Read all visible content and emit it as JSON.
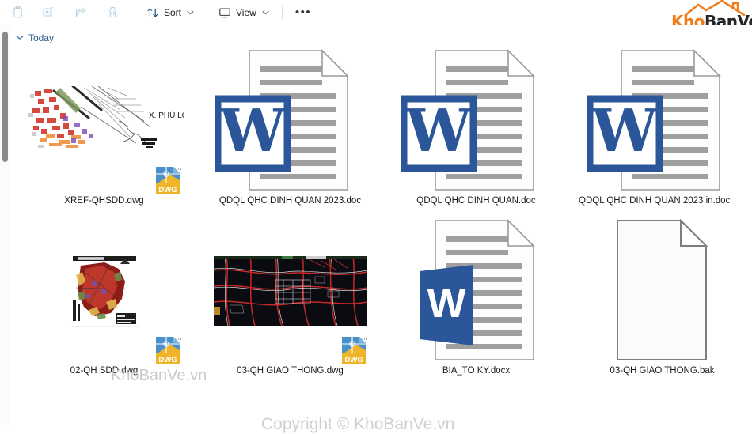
{
  "toolbar": {
    "buttons": [
      {
        "name": "paste-button",
        "icon": "paste-icon",
        "label": "",
        "disabled": true
      },
      {
        "name": "rename-button",
        "icon": "rename-icon",
        "label": "",
        "disabled": true
      },
      {
        "name": "share-button",
        "icon": "share-icon",
        "label": "",
        "disabled": true
      },
      {
        "name": "delete-button",
        "icon": "trash-icon",
        "label": "",
        "disabled": true
      }
    ],
    "sort_label": "Sort",
    "view_label": "View",
    "overflow_label": "•••"
  },
  "logo": {
    "part1": "Kho",
    "part2": "BanVe",
    "color1": "#ef7d1a",
    "color2": "#262626"
  },
  "group": {
    "title": "Today",
    "expanded": true
  },
  "files": [
    {
      "name": "XREF-QHSDD.dwg",
      "type": "dwg",
      "thumb": "cad-map-light",
      "thumb_text": "X. PHÚ LỢI",
      "has_dwg_badge": true,
      "truncated": false
    },
    {
      "name": "QDQL QHC DINH QUAN 2023.doc",
      "type": "doc",
      "thumb": "word-doc-classic",
      "has_dwg_badge": false,
      "truncated": false
    },
    {
      "name": "QDQL QHC DINH QUAN.doc",
      "type": "doc",
      "thumb": "word-doc-classic",
      "has_dwg_badge": false,
      "truncated": false
    },
    {
      "name": "QDQL QHC DINH QUAN 2023 in.doc",
      "type": "doc",
      "thumb": "word-doc-classic",
      "has_dwg_badge": false,
      "truncated": true
    },
    {
      "name": "02-QH SDD.dwg",
      "type": "dwg",
      "thumb": "cad-map-color",
      "has_dwg_badge": true,
      "truncated": false
    },
    {
      "name": "03-QH GIAO THONG.dwg",
      "type": "dwg",
      "thumb": "cad-map-dark",
      "has_dwg_badge": true,
      "truncated": false
    },
    {
      "name": "BIA_TO KY.docx",
      "type": "docx",
      "thumb": "word-docx-modern",
      "has_dwg_badge": false,
      "truncated": false
    },
    {
      "name": "03-QH GIAO THONG.bak",
      "type": "bak",
      "thumb": "blank-page",
      "has_dwg_badge": false,
      "truncated": false
    }
  ],
  "watermarks": {
    "middle": "KhoBanVe.vn",
    "bottom": "Copyright © KhoBanVe.vn"
  },
  "colors": {
    "word_blue": "#2b579a",
    "dwg_blue": "#4a90c9",
    "dwg_yellow": "#f0b429",
    "accent_orange": "#ef7d1a",
    "group_header": "#2f5f8f"
  }
}
